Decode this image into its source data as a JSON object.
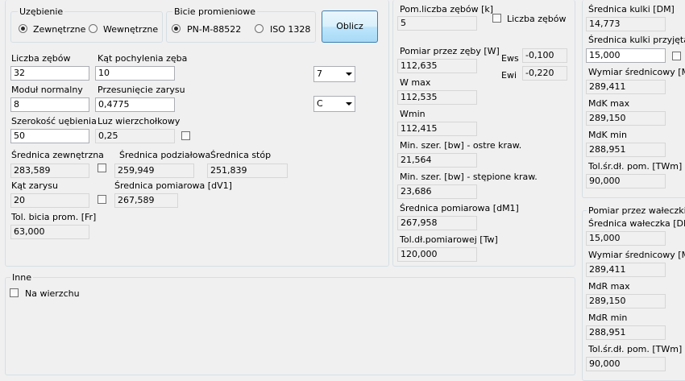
{
  "gearing": {
    "title": "Uzębienie",
    "options": [
      "Zewnętrzne",
      "Wewnętrzne"
    ],
    "selected": 0
  },
  "runout": {
    "title": "Bicie promieniowe",
    "options": [
      "PN-M-88522",
      "ISO 1328"
    ],
    "selected": 0
  },
  "compute_button": "Oblicz",
  "params": {
    "teeth_label": "Liczba zębów",
    "teeth_value": "32",
    "helix_label": "Kąt pochylenia zęba",
    "helix_value": "10",
    "module_label": "Moduł normalny",
    "module_value": "8",
    "shift_label": "Przesunięcie zarysu",
    "shift_value": "0,4775",
    "width_label": "Szerokość uębienia",
    "width_value": "50",
    "clearance_label": "Luz wierzchołkowy",
    "clearance_value": "0,25",
    "combo1": "7",
    "combo2": "C"
  },
  "diameters": {
    "outer_label": "Średnica zewnętrzna",
    "outer_value": "283,589",
    "pitch_label": "Średnica podziałowa",
    "pitch_value": "259,949",
    "root_label": "Średnica stóp",
    "root_value": "251,839",
    "pressure_angle_label": "Kąt zarysu",
    "pressure_angle_value": "20",
    "measure_label": "Średnica pomiarowa [dV1]",
    "measure_value": "267,589",
    "runout_tol_label": "Tol. bicia prom. [Fr]",
    "runout_tol_value": "63,000"
  },
  "other": {
    "title": "Inne",
    "on_top_label": "Na wierzchu"
  },
  "span": {
    "teeth_count_label": "Pom.liczba zębów [k]",
    "teeth_count_value": "5",
    "teeth_checkbox_label": "Liczba zębów",
    "over_teeth_label": "Pomiar przez zęby [W]",
    "over_teeth_value": "112,635",
    "ews_label": "Ews",
    "ews_value": "-0,100",
    "ewi_label": "Ewi",
    "ewi_value": "-0,220",
    "wmax_label": "W max",
    "wmax_value": "112,535",
    "wmin_label": "Wmin",
    "wmin_value": "112,415",
    "minw_sharp_label": "Min. szer. [bw] - ostre kraw.",
    "minw_sharp_value": "21,564",
    "minw_blunt_label": "Min. szer. [bw] - stępione kraw.",
    "minw_blunt_value": "23,686",
    "dm1_label": "Średnica pomiarowa [dM1]",
    "dm1_value": "267,958",
    "tw_label": "Tol.dł.pomiarowej [Tw]",
    "tw_value": "120,000"
  },
  "balls": {
    "dm_label": "Średnica kulki [DM]",
    "dm_value": "14,773",
    "dm_adopted_label": "Średnica kulki przyjęta [D",
    "dm_adopted_value": "15,000",
    "mdk_label": "Wymiar średnicowy [MdK",
    "mdk_value": "289,411",
    "mdk_max_label": "MdK max",
    "mdk_max_value": "289,150",
    "mdk_min_label": "MdK min",
    "mdk_min_value": "288,951",
    "twm_label": "Tol.śr.dł. pom. [TWm]",
    "twm_value": "90,000"
  },
  "rollers": {
    "title": "Pomiar przez wałeczki",
    "dm_label": "Średnica wałeczka [DM",
    "dm_value": "15,000",
    "mdr_label": "Wymiar średnicowy [MdR",
    "mdr_value": "289,411",
    "mdr_max_label": "MdR max",
    "mdr_max_value": "289,150",
    "mdr_min_label": "MdR min",
    "mdr_min_value": "288,951",
    "twm_label": "Tol.śr.dł. pom. [TWm]",
    "twm_value": "90,000"
  }
}
